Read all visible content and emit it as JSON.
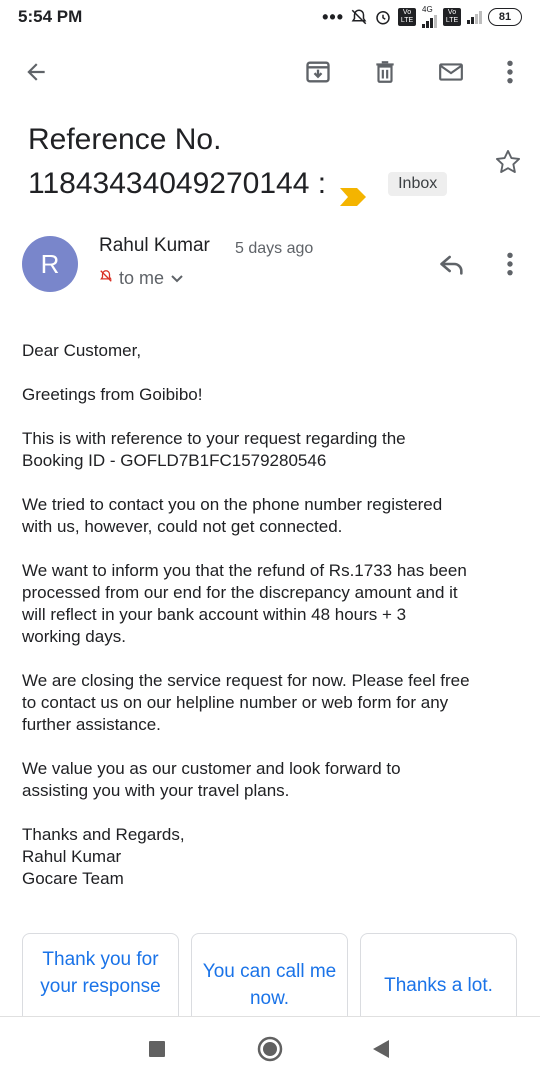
{
  "status_bar": {
    "time": "5:54 PM",
    "network_label": "4G",
    "volte_label_1": "Vo LTE",
    "volte_label_2": "Vo LTE",
    "battery": "81",
    "icons": [
      "more-dots-icon",
      "mute-bell-icon",
      "alarm-icon",
      "signal-icon",
      "battery-icon"
    ]
  },
  "toolbar": {
    "icons": [
      "back-arrow-icon",
      "archive-icon",
      "delete-icon",
      "mark-unread-icon",
      "more-vert-icon"
    ]
  },
  "email": {
    "subject_line1": "Reference No.",
    "subject_line2": "11843434049270144 :",
    "label": "Inbox",
    "sender_initial": "R",
    "sender_name": "Rahul Kumar",
    "sent_time": "5 days ago",
    "recipient": "to me",
    "body": [
      "Dear Customer,",
      "Greetings from Goibibo!",
      "This is with reference to your request regarding the\nBooking ID - GOFLD7B1FC1579280546",
      "We tried to contact you on the phone number registered\nwith us, however, could not get connected.",
      "We want to inform you that the refund of Rs.1733 has been\nprocessed from our end for the discrepancy amount and it\nwill reflect in your bank account within 48 hours + 3\nworking days.",
      "We are closing the service request for now. Please feel free\nto contact us on our helpline number or web form for any\nfurther assistance.",
      "We value you as our customer and look forward to\nassisting you with your travel plans.",
      "Thanks and Regards,\nRahul Kumar\nGocare Team"
    ]
  },
  "smart_replies": [
    "Thank you for your response",
    "You can call me now.",
    "Thanks a lot."
  ],
  "colors": {
    "avatar": "#7986cb",
    "importance": "#f4b400",
    "link": "#1a73e8"
  }
}
